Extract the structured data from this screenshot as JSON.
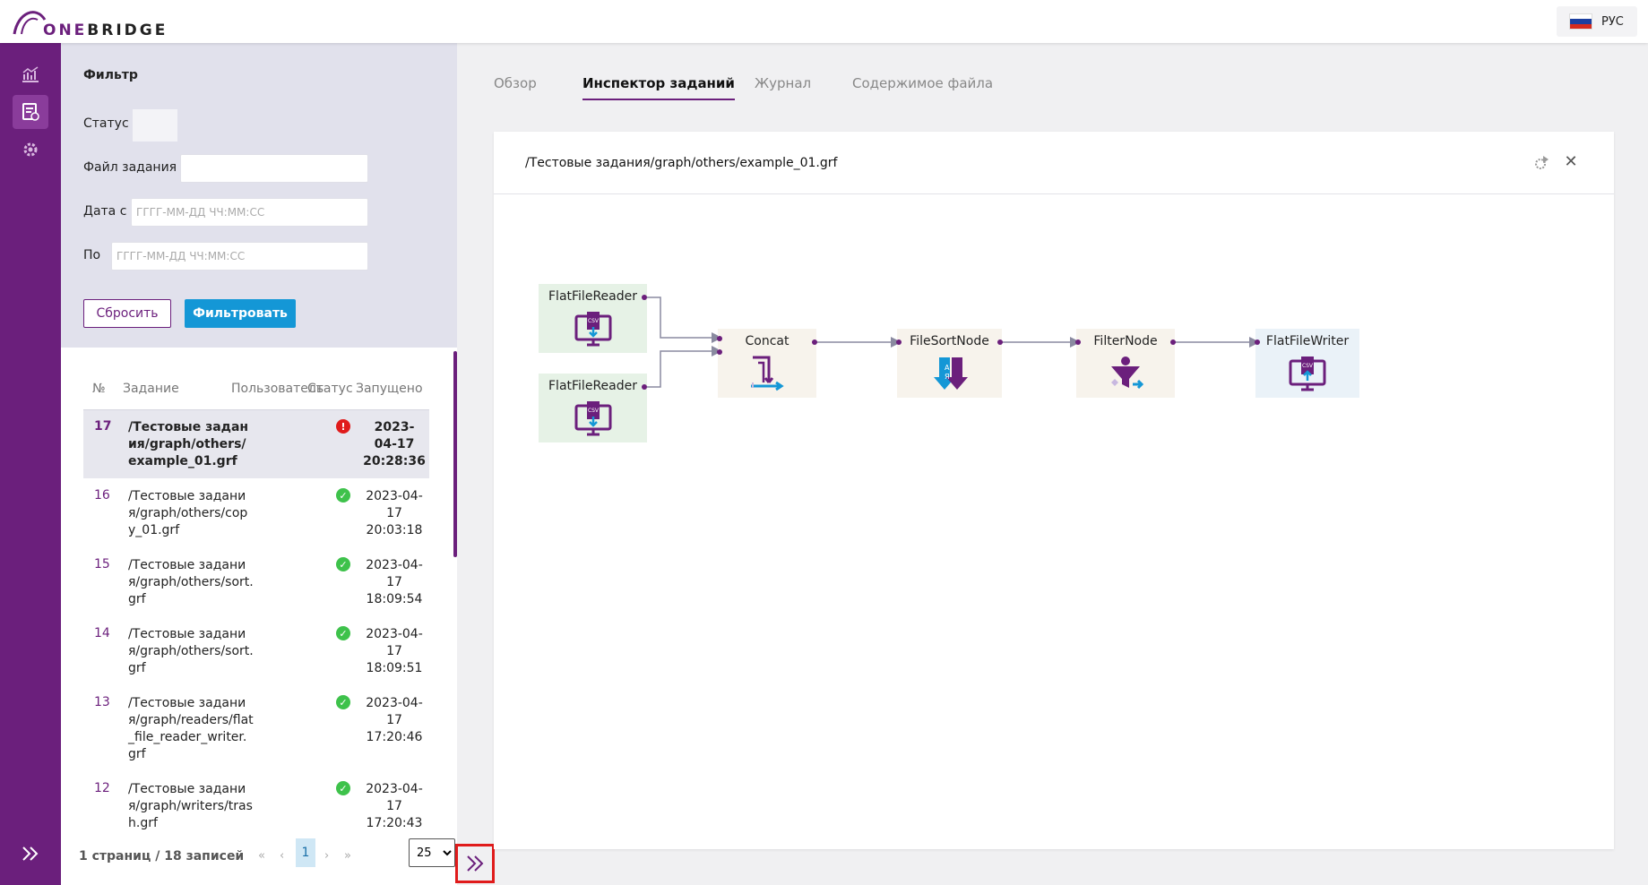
{
  "header": {
    "logo_one": "ONE",
    "logo_bridge": "BRIDGE",
    "language": "РУС",
    "flag_colors": [
      "#ffffff",
      "#1c3fa0",
      "#d52b1e"
    ]
  },
  "rail": {
    "items": [
      {
        "icon": "chart-icon"
      },
      {
        "icon": "jobs-icon",
        "active": true
      },
      {
        "icon": "settings-icon"
      }
    ],
    "expand_icon": "double-chevron-right-icon"
  },
  "filter": {
    "title": "Фильтр",
    "status_label": "Статус",
    "file_label": "Файл задания",
    "file_value": "",
    "date_from_label": "Дата с",
    "date_from_placeholder": "ГГГГ-ММ-ДД ЧЧ:ММ:СС",
    "date_to_label": "По",
    "date_to_placeholder": "ГГГГ-ММ-ДД ЧЧ:ММ:СС",
    "reset_label": "Сбросить",
    "apply_label": "Фильтровать"
  },
  "jobs": {
    "columns": [
      "№",
      "Задание",
      "Пользователь",
      "Статус",
      "Запущено"
    ],
    "rows": [
      {
        "num": "17",
        "job": "/Тестовые задания/graph/others/example_01.grf",
        "status": "error",
        "date": "2023-04-17",
        "time": "20:28:36",
        "selected": true
      },
      {
        "num": "16",
        "job": "/Тестовые задания/graph/others/copy_01.grf",
        "status": "ok",
        "date": "2023-04-17",
        "time": "20:03:18"
      },
      {
        "num": "15",
        "job": "/Тестовые задания/graph/others/sort.grf",
        "status": "ok",
        "date": "2023-04-17",
        "time": "18:09:54"
      },
      {
        "num": "14",
        "job": "/Тестовые задания/graph/others/sort.grf",
        "status": "ok",
        "date": "2023-04-17",
        "time": "18:09:51"
      },
      {
        "num": "13",
        "job": "/Тестовые задания/graph/readers/flat_file_reader_writer.grf",
        "status": "ok",
        "date": "2023-04-17",
        "time": "17:20:46"
      },
      {
        "num": "12",
        "job": "/Тестовые задания/graph/writers/trash.grf",
        "status": "ok",
        "date": "2023-04-17",
        "time": "17:20:43"
      }
    ],
    "pager": {
      "info": "1 страниц / 18 записей",
      "first": "«",
      "prev": "‹",
      "current": "1",
      "next": "›",
      "last": "»",
      "page_size": "25"
    }
  },
  "tabs": [
    {
      "label": "Обзор"
    },
    {
      "label": "Инспектор заданий",
      "active": true
    },
    {
      "label": "Журнал"
    },
    {
      "label": "Содержимое файла"
    }
  ],
  "inspector": {
    "title": "/Тестовые задания/graph/others/example_01.grf",
    "actions": [
      "run-icon",
      "close-icon"
    ],
    "close_glyph": "✕",
    "nodes": [
      {
        "id": "reader1",
        "label": "FlatFileReader",
        "icon": "csv-reader-icon"
      },
      {
        "id": "reader2",
        "label": "FlatFileReader",
        "icon": "csv-reader-icon"
      },
      {
        "id": "concat",
        "label": "Concat",
        "icon": "concat-icon"
      },
      {
        "id": "sort",
        "label": "FileSortNode",
        "icon": "sort-icon"
      },
      {
        "id": "filter",
        "label": "FilterNode",
        "icon": "filter-icon"
      },
      {
        "id": "writer",
        "label": "FlatFileWriter",
        "icon": "csv-writer-icon"
      }
    ],
    "edges": [
      [
        "reader1",
        "concat"
      ],
      [
        "reader2",
        "concat"
      ],
      [
        "concat",
        "sort"
      ],
      [
        "sort",
        "filter"
      ],
      [
        "filter",
        "writer"
      ]
    ]
  },
  "colors": {
    "brand": "#6b1f7c",
    "accent": "#1497d6",
    "ok": "#3ec24b",
    "error": "#e01b1b"
  }
}
